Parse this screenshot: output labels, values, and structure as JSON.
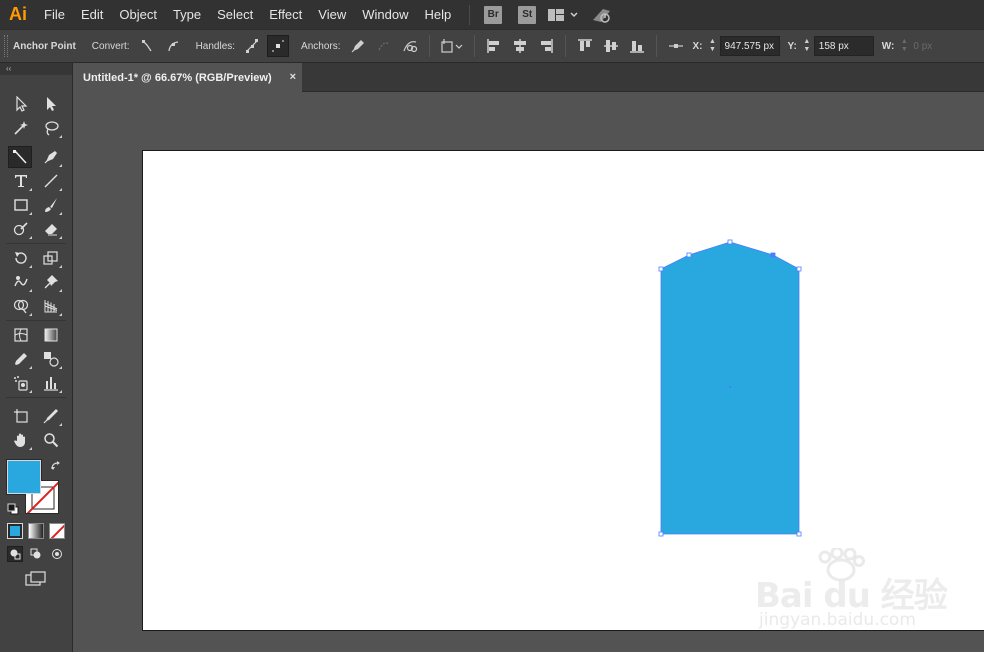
{
  "app": {
    "logo": "Ai"
  },
  "menu": {
    "items": [
      "File",
      "Edit",
      "Object",
      "Type",
      "Select",
      "Effect",
      "View",
      "Window",
      "Help"
    ],
    "bridge_badge": "Br",
    "stock_badge": "St"
  },
  "controlbar": {
    "title": "Anchor Point",
    "convert_label": "Convert:",
    "handles_label": "Handles:",
    "anchors_label": "Anchors:",
    "x_label": "X:",
    "x_value": "947.575 px",
    "y_label": "Y:",
    "y_value": "158 px",
    "w_label": "W:",
    "w_value": "0 px"
  },
  "tools": {
    "collapse_glyph": "‹‹",
    "active_tool": "curvature-tool",
    "fill_color": "#29a8e0",
    "stroke": "none"
  },
  "document": {
    "tab_title": "Untitled-1* @ 66.67% (RGB/Preview)",
    "tab_close": "×"
  },
  "artwork": {
    "shape_fill": "#29a8e0",
    "selection_color": "#4a7dff"
  },
  "watermark": {
    "line1": "Bai du 经验",
    "line2": "jingyan.baidu.com"
  }
}
